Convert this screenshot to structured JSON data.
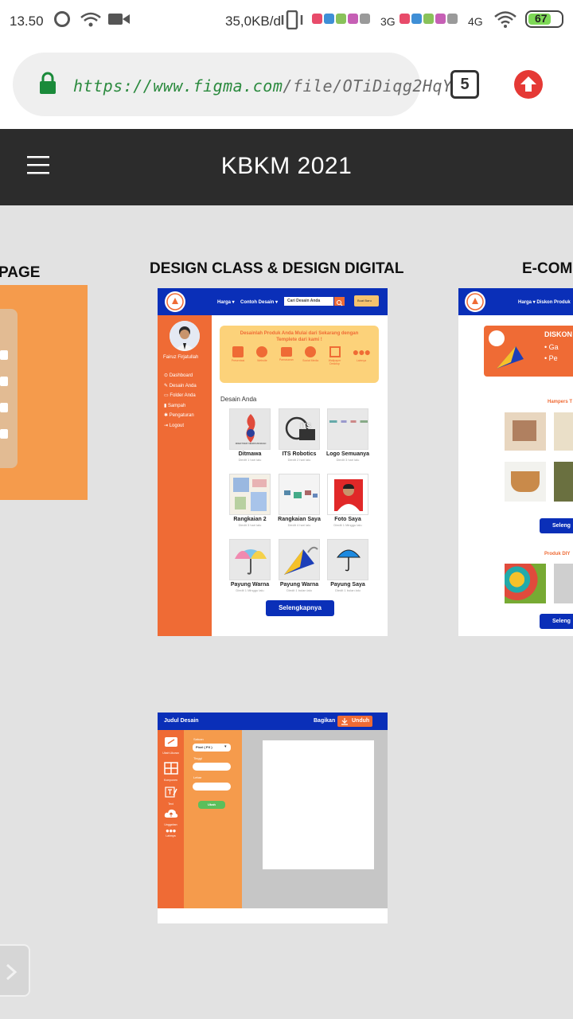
{
  "status": {
    "time": "13.50",
    "speed": "35,0KB/d",
    "net_3g": "3G",
    "net_4g": "4G",
    "battery": "67"
  },
  "browser": {
    "url_scheme": "https://",
    "url_host": "www.figma.com",
    "url_path": "/file/OTiDiqg2HqY",
    "tab_count": "5"
  },
  "app": {
    "title": "KBKM 2021"
  },
  "canvas": {
    "left_label": "PAGE",
    "center_label": "DESIGN CLASS & DESIGN DIGITAL",
    "right_label": "E-COM"
  },
  "frame1": {
    "nav": {
      "harga": "Harga ▾",
      "contoh": "Contoh Desain ▾",
      "search_placeholder": "Cari Desain Anda",
      "button": "Buat Baru"
    },
    "profile_name": "Fairuz Firjatullah",
    "menu": [
      "Dashboard",
      "Desain Anda",
      "Folder Anda",
      "Sampah",
      "Pengaturan",
      "Logout"
    ],
    "banner_title": "Desainlah Produk Anda Mulai dari Sekarang dengan Templete dari kami !",
    "banner_items": [
      "Presentasi",
      "Website",
      "Pamasaran",
      "Social Media",
      "Wallpaper Desktop",
      "Lainnya"
    ],
    "section_title": "Desain Anda",
    "designs": [
      {
        "title": "Ditmawa",
        "sub": "Diedit 1 hari lalu"
      },
      {
        "title": "ITS Robotics",
        "sub": "Diedit 2 hari lalu"
      },
      {
        "title": "Logo Semuanya",
        "sub": "Diedit 3 hari lalu"
      },
      {
        "title": "Rangkaian 2",
        "sub": "Diedit 3 hari lalu"
      },
      {
        "title": "Rangkaian Saya",
        "sub": "Diedit 4 hari lalu"
      },
      {
        "title": "Foto Saya",
        "sub": "Diedit 1 Minggu lalu"
      },
      {
        "title": "Payung Warna",
        "sub": "Diedit 1 Minggu lalu"
      },
      {
        "title": "Payung Warna",
        "sub": "Diedit 1 bulan lalu"
      },
      {
        "title": "Payung Saya",
        "sub": "Diedit 1 bulan lalu"
      }
    ],
    "more_button": "Selengkapnya",
    "its_text": "ITS",
    "ditmawa_text": "DIREKTORAT KEMAHASISWAAN"
  },
  "frame2": {
    "title": "Judul Desain",
    "share": "Bagikan",
    "download": "Unduh",
    "tools": [
      "Ubah Ukuran",
      "Komponen",
      "Text",
      "Unggahan",
      "Lainnya"
    ],
    "size_label": "Satuan",
    "unit_value": "Pixel ( PX )",
    "height_label": "Tinggi",
    "width_label": "Lebar",
    "apply_button": "Ubah"
  },
  "frame3": {
    "nav": "Harga ▾   Diskon Produk",
    "promo_title": "DISKON",
    "promo_items": [
      "Ga",
      "Pe"
    ],
    "section1": "Hampers T",
    "section2": "Produk DIY",
    "more": "Seleng"
  },
  "colors": {
    "accent_orange": "#ef6b35",
    "light_orange": "#f59b4c",
    "nav_blue": "#0a2fb8",
    "header_dark": "#2c2c2c",
    "url_green": "#2b8a3e"
  }
}
